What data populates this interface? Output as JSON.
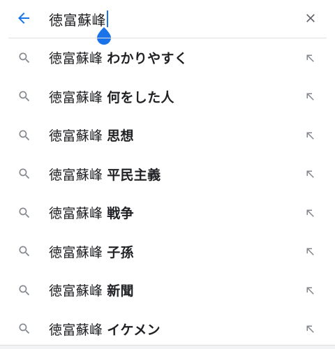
{
  "search": {
    "query": "徳富蘇峰",
    "accent_color": "#1a73e8"
  },
  "icons": {
    "back": "arrow-left-icon",
    "clear": "close-icon",
    "suggestion": "search-icon",
    "fill": "arrow-up-left-icon"
  },
  "suggestions": [
    {
      "prefix": "徳富蘇峰",
      "suffix": "わかりやすく"
    },
    {
      "prefix": "徳富蘇峰",
      "suffix": "何をした人"
    },
    {
      "prefix": "徳富蘇峰",
      "suffix": "思想"
    },
    {
      "prefix": "徳富蘇峰",
      "suffix": "平民主義"
    },
    {
      "prefix": "徳富蘇峰",
      "suffix": "戦争"
    },
    {
      "prefix": "徳富蘇峰",
      "suffix": "子孫"
    },
    {
      "prefix": "徳富蘇峰",
      "suffix": "新聞"
    },
    {
      "prefix": "徳富蘇峰",
      "suffix": "イケメン"
    }
  ]
}
